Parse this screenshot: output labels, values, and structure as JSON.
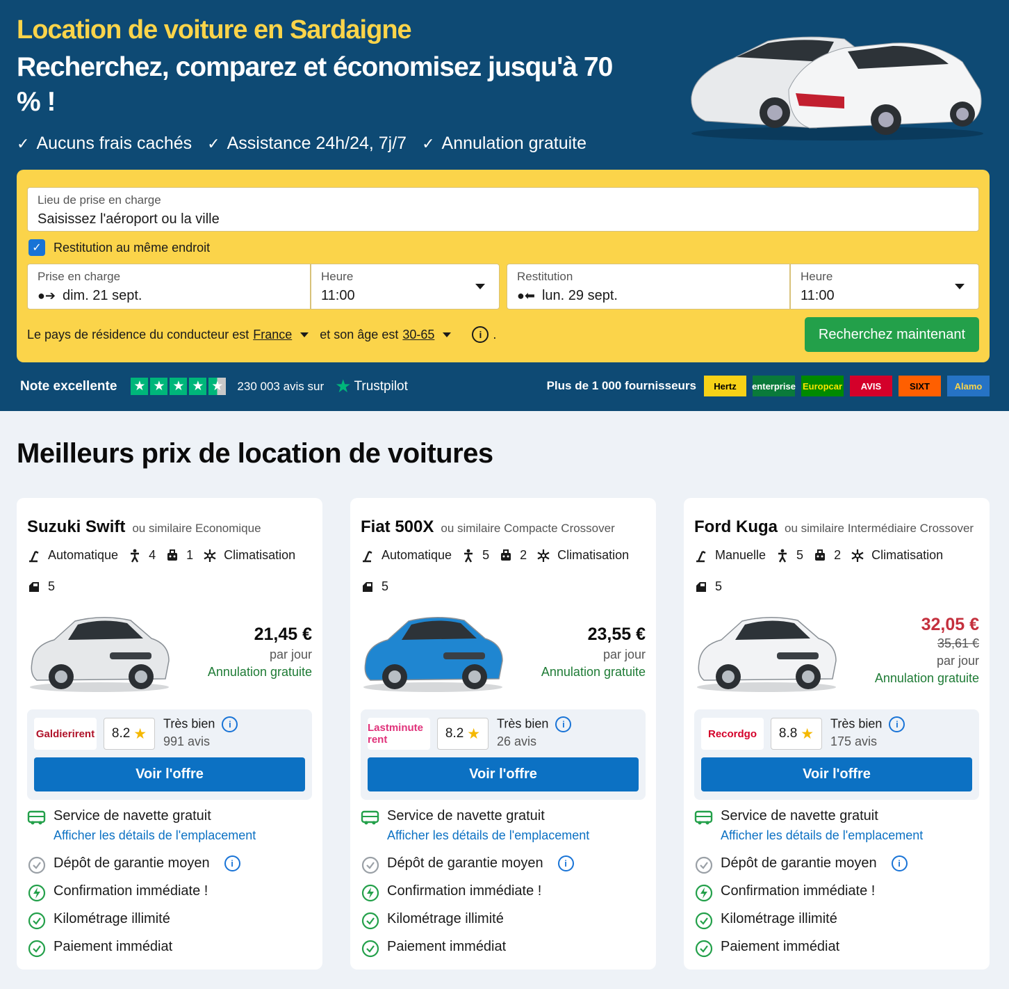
{
  "hero": {
    "title": "Location de voiture en Sardaigne",
    "subtitle": "Recherchez, comparez et économisez jusqu'à 70 % !",
    "perks": [
      "Aucuns frais cachés",
      "Assistance 24h/24, 7j/7",
      "Annulation gratuite"
    ]
  },
  "search": {
    "pickup_location_label": "Lieu de prise en charge",
    "pickup_location_placeholder": "Saisissez l'aéroport ou la ville",
    "same_place_label": "Restitution au même endroit",
    "same_place_checked": true,
    "pickup_label": "Prise en charge",
    "pickup_date": "dim. 21 sept.",
    "pickup_time_label": "Heure",
    "pickup_time": "11:00",
    "return_label": "Restitution",
    "return_date": "lun. 29 sept.",
    "return_time_label": "Heure",
    "return_time": "11:00",
    "residence_prefix": "Le pays de résidence du conducteur est",
    "country": "France",
    "age_prefix": "et son âge est",
    "age": "30-65",
    "period": ".",
    "button": "Recherchez maintenant"
  },
  "trust": {
    "note": "Note excellente",
    "reviews": "230 003 avis sur",
    "brand": "Trustpilot",
    "rating": 4.5,
    "suppliers_label": "Plus de 1 000 fournisseurs",
    "suppliers": [
      {
        "name": "Hertz",
        "bg": "#f7d117",
        "fg": "#000000"
      },
      {
        "name": "enterprise",
        "bg": "#0a7a3a",
        "fg": "#ffffff"
      },
      {
        "name": "Europcar",
        "bg": "#008a00",
        "fg": "#fbe500"
      },
      {
        "name": "AVIS",
        "bg": "#d4002a",
        "fg": "#ffffff"
      },
      {
        "name": "SIXT",
        "bg": "#ff5f00",
        "fg": "#000000"
      },
      {
        "name": "Alamo",
        "bg": "#2673c5",
        "fg": "#fbd44a"
      }
    ]
  },
  "section_title": "Meilleurs prix de location de voitures",
  "cards": [
    {
      "name": "Suzuki Swift",
      "similar": "ou similaire Economique",
      "transmission": "Automatique",
      "seats": "4",
      "bags": "1",
      "ac": "Climatisation",
      "doors": "5",
      "price": "21,45 €",
      "old_price": "",
      "per_day": "par jour",
      "cancel": "Annulation gratuite",
      "supplier": "Galdierirent",
      "score": "8.2",
      "score_label": "Très bien",
      "reviews": "991 avis",
      "button": "Voir l'offre",
      "car_color": "#e6e8ea",
      "features": {
        "shuttle": "Service de navette gratuit",
        "location_link": "Afficher les détails de l'emplacement",
        "deposit": "Dépôt de garantie moyen",
        "confirm": "Confirmation immédiate !",
        "mileage": "Kilométrage illimité",
        "payment": "Paiement immédiat"
      }
    },
    {
      "name": "Fiat 500X",
      "similar": "ou similaire Compacte Crossover",
      "transmission": "Automatique",
      "seats": "5",
      "bags": "2",
      "ac": "Climatisation",
      "doors": "5",
      "price": "23,55 €",
      "old_price": "",
      "per_day": "par jour",
      "cancel": "Annulation gratuite",
      "supplier": "Lastminute rent",
      "score": "8.2",
      "score_label": "Très bien",
      "reviews": "26 avis",
      "button": "Voir l'offre",
      "car_color": "#1f86d1",
      "features": {
        "shuttle": "Service de navette gratuit",
        "location_link": "Afficher les détails de l'emplacement",
        "deposit": "Dépôt de garantie moyen",
        "confirm": "Confirmation immédiate !",
        "mileage": "Kilométrage illimité",
        "payment": "Paiement immédiat"
      }
    },
    {
      "name": "Ford Kuga",
      "similar": "ou similaire Intermédiaire Crossover",
      "transmission": "Manuelle",
      "seats": "5",
      "bags": "2",
      "ac": "Climatisation",
      "doors": "5",
      "price": "32,05 €",
      "old_price": "35,61 €",
      "per_day": "par jour",
      "cancel": "Annulation gratuite",
      "supplier": "Recordgo",
      "score": "8.8",
      "score_label": "Très bien",
      "reviews": "175 avis",
      "button": "Voir l'offre",
      "car_color": "#f2f3f5",
      "features": {
        "shuttle": "Service de navette gratuit",
        "location_link": "Afficher les détails de l'emplacement",
        "deposit": "Dépôt de garantie moyen",
        "confirm": "Confirmation immédiate !",
        "mileage": "Kilométrage illimité",
        "payment": "Paiement immédiat"
      }
    }
  ]
}
